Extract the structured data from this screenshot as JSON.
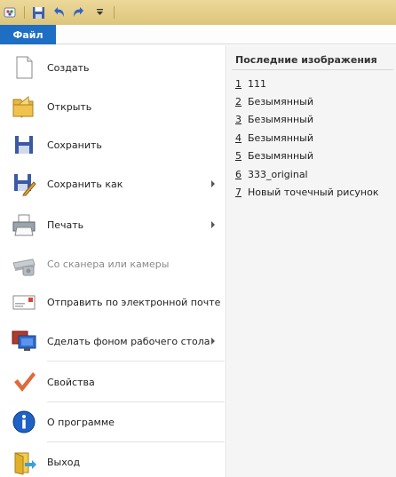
{
  "ribbon": {
    "file_tab": "Файл"
  },
  "qat": {
    "icons": [
      "paint-app-icon",
      "save-icon",
      "undo-icon",
      "redo-icon",
      "customize-dropdown-icon"
    ]
  },
  "menu": {
    "items": [
      {
        "label": "Создать",
        "icon": "new-document-icon",
        "submenu": false,
        "enabled": true
      },
      {
        "label": "Открыть",
        "icon": "open-folder-icon",
        "submenu": false,
        "enabled": true
      },
      {
        "label": "Сохранить",
        "icon": "save-icon",
        "submenu": false,
        "enabled": true
      },
      {
        "label": "Сохранить как",
        "icon": "save-as-icon",
        "submenu": true,
        "enabled": true
      },
      {
        "label": "Печать",
        "icon": "printer-icon",
        "submenu": true,
        "enabled": true
      },
      {
        "label": "Со сканера или камеры",
        "icon": "scanner-icon",
        "submenu": false,
        "enabled": false
      },
      {
        "label": "Отправить по электронной почте",
        "icon": "email-icon",
        "submenu": false,
        "enabled": true
      },
      {
        "label": "Сделать фоном рабочего стола",
        "icon": "desktop-background-icon",
        "submenu": true,
        "enabled": true
      },
      {
        "label": "Свойства",
        "icon": "checkmark-icon",
        "submenu": false,
        "enabled": true
      },
      {
        "label": "О программе",
        "icon": "info-icon",
        "submenu": false,
        "enabled": true
      },
      {
        "label": "Выход",
        "icon": "exit-icon",
        "submenu": false,
        "enabled": true
      }
    ]
  },
  "recent": {
    "title": "Последние изображения",
    "items": [
      {
        "num": "1",
        "name": "111"
      },
      {
        "num": "2",
        "name": "Безымянный"
      },
      {
        "num": "3",
        "name": "Безымянный"
      },
      {
        "num": "4",
        "name": "Безымянный"
      },
      {
        "num": "5",
        "name": "Безымянный"
      },
      {
        "num": "6",
        "name": "333_original"
      },
      {
        "num": "7",
        "name": "Новый точечный рисунок"
      }
    ]
  }
}
